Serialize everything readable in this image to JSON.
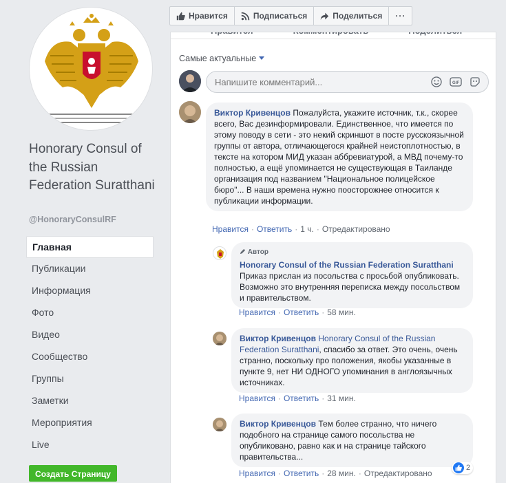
{
  "page": {
    "name": "Honorary Consul of the Russian Federation Suratthani",
    "handle": "@HonoraryConsulRF",
    "create_button": "Создать Страницу"
  },
  "nav": {
    "items": [
      {
        "label": "Главная",
        "active": true
      },
      {
        "label": "Публикации"
      },
      {
        "label": "Информация"
      },
      {
        "label": "Фото"
      },
      {
        "label": "Видео"
      },
      {
        "label": "Сообщество"
      },
      {
        "label": "Группы"
      },
      {
        "label": "Заметки"
      },
      {
        "label": "Мероприятия"
      },
      {
        "label": "Live"
      }
    ]
  },
  "topbar": {
    "like": "Нравится",
    "follow": "Подписаться",
    "share": "Поделиться",
    "more": "···"
  },
  "post_actions": {
    "like": "Нравится",
    "comment": "Комментировать",
    "share": "Поделиться"
  },
  "comments_section": {
    "sort_label": "Самые актуальные",
    "input_placeholder": "Напишите комментарий..."
  },
  "comments": [
    {
      "author": "Виктор Кривенцов",
      "text": "Пожалуйста, укажите источник, т.к., скорее всего, Вас дезинформировали. Единственное, что имеется по этому поводу в сети - это некий скриншот в посте русскоязычной группы от автора, отличающегося крайней неистоплотностью, в тексте на котором МИД указан аббревиатурой, а МВД почему-то полностью, а ещё упоминается не существующая в Таиланде организация под названием \"Национальное полицейское бюро\"... В наши времена нужно поосторожнее относится к публикации информации.",
      "like": "Нравится",
      "reply": "Ответить",
      "time": "1 ч.",
      "edited": "Отредактировано"
    },
    {
      "badge": "Автор",
      "author": "Honorary Consul of the Russian Federation Suratthani",
      "text": "Приказ прислан из посольства с просьбой опубликовать. Возможно это внутренняя переписка между посольством и правительством.",
      "like": "Нравится",
      "reply": "Ответить",
      "time": "58 мин."
    },
    {
      "author": "Виктор Кривенцов",
      "tagged": "Honorary Consul of the Russian Federation Suratthani",
      "text": ", спасибо за ответ. Это очень, очень странно, поскольку про положения, якобы указанные в пункте 9, нет НИ ОДНОГО упоминания в англоязычных источниках.",
      "like": "Нравится",
      "reply": "Ответить",
      "time": "31 мин."
    },
    {
      "author": "Виктор Кривенцов",
      "text": "Тем более странно, что ничего подобного на странице самого посольства не опубликовано, равно как и на странице тайского правительства...",
      "like": "Нравится",
      "reply": "Ответить",
      "time": "28 мин.",
      "edited": "Отредактировано",
      "reactions": "2"
    }
  ],
  "colors": {
    "link": "#385898",
    "like_blue": "#2078f4",
    "create_green": "#42b72a"
  }
}
